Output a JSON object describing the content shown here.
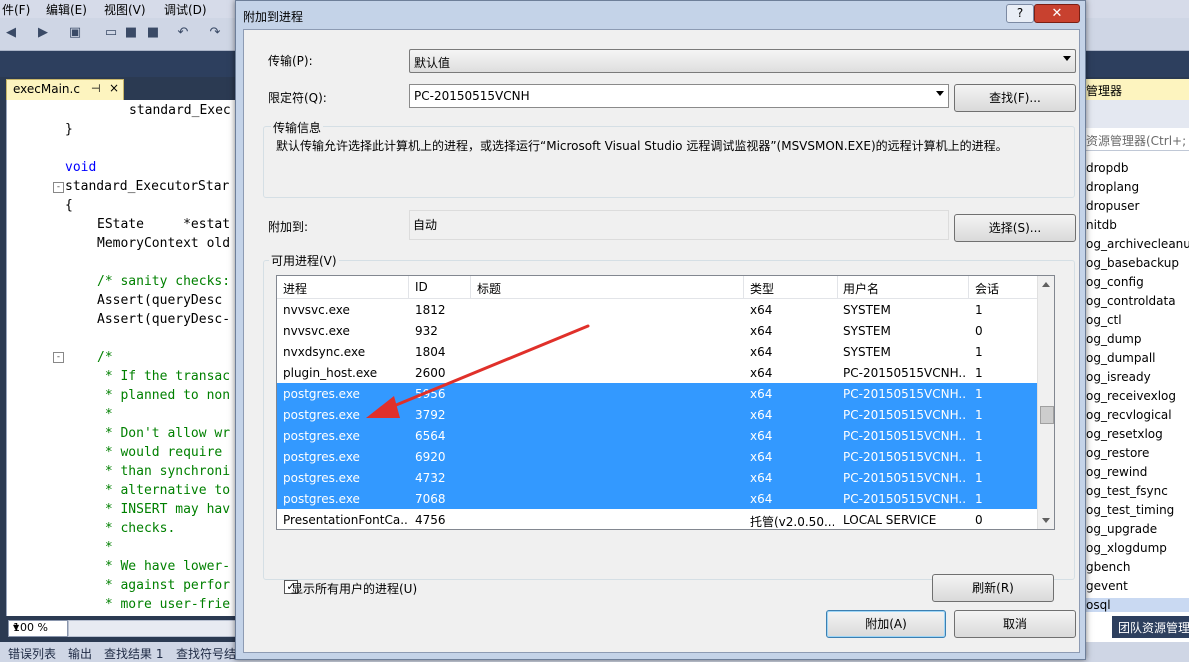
{
  "ide": {
    "menu": [
      "件(F)",
      "编辑(E)",
      "视图(V)",
      "调试(D)"
    ],
    "tab": {
      "file": "execMain.c",
      "pin": "⊣",
      "close": "×"
    },
    "code_lines": [
      {
        "text": "standard_Exec",
        "cls": "tx",
        "indent": 64
      },
      {
        "text": "}",
        "cls": "tx",
        "indent": 0
      },
      {
        "text": "",
        "cls": "tx",
        "indent": 0
      },
      {
        "text": "void",
        "cls": "kw",
        "indent": 0
      },
      {
        "text": "standard_ExecutorStar",
        "cls": "tx",
        "indent": 0
      },
      {
        "text": "{",
        "cls": "tx",
        "indent": 0
      },
      {
        "text": "EState     *estat",
        "cls": "tx",
        "indent": 32
      },
      {
        "text": "MemoryContext old",
        "cls": "tx",
        "indent": 32
      },
      {
        "text": "",
        "cls": "tx",
        "indent": 0
      },
      {
        "text": "/* sanity checks:",
        "cls": "cm",
        "indent": 32
      },
      {
        "text": "Assert(queryDesc ",
        "cls": "tx",
        "indent": 32
      },
      {
        "text": "Assert(queryDesc-",
        "cls": "tx",
        "indent": 32
      },
      {
        "text": "",
        "cls": "tx",
        "indent": 0
      },
      {
        "text": "/*",
        "cls": "cm",
        "indent": 32
      },
      {
        "text": " * If the transac",
        "cls": "cm",
        "indent": 32
      },
      {
        "text": " * planned to non",
        "cls": "cm",
        "indent": 32
      },
      {
        "text": " *",
        "cls": "cm",
        "indent": 32
      },
      {
        "text": " * Don't allow wr",
        "cls": "cm",
        "indent": 32
      },
      {
        "text": " * would require ",
        "cls": "cm",
        "indent": 32
      },
      {
        "text": " * than synchroni",
        "cls": "cm",
        "indent": 32
      },
      {
        "text": " * alternative to",
        "cls": "cm",
        "indent": 32
      },
      {
        "text": " * INSERT may hav",
        "cls": "cm",
        "indent": 32
      },
      {
        "text": " * checks.",
        "cls": "cm",
        "indent": 32
      },
      {
        "text": " *",
        "cls": "cm",
        "indent": 32
      },
      {
        "text": " * We have lower-",
        "cls": "cm",
        "indent": 32
      },
      {
        "text": " * against perfor",
        "cls": "cm",
        "indent": 32
      },
      {
        "text": " * more user-frie",
        "cls": "cm",
        "indent": 32
      }
    ],
    "zoom": "100 %",
    "bottom_tabs": [
      "错误列表",
      "输出",
      "查找结果 1",
      "查找符号结"
    ],
    "solution_explorer": {
      "title": "管理器",
      "search_placeholder": "资源管理器(Ctrl+;",
      "items": [
        "dropdb",
        "droplang",
        "dropuser",
        "nitdb",
        "og_archivecleanup",
        "og_basebackup",
        "og_config",
        "og_controldata",
        "og_ctl",
        "og_dump",
        "og_dumpall",
        "og_isready",
        "og_receivexlog",
        "og_recvlogical",
        "og_resetxlog",
        "og_restore",
        "og_rewind",
        "og_test_fsync",
        "og_test_timing",
        "og_upgrade",
        "og_xlogdump",
        "gbench",
        "gevent",
        "osql"
      ],
      "selected_index": 23,
      "bottom_tab": "团队资源管理"
    }
  },
  "dialog": {
    "title": "附加到进程",
    "help": "?",
    "close": "✕",
    "transport_label": "传输(P):",
    "transport_value": "默认值",
    "qualifier_label": "限定符(Q):",
    "qualifier_value": "PC-20150515VCNH",
    "find_button": "查找(F)...",
    "transport_info_label": "传输信息",
    "transport_info_text": "默认传输允许选择此计算机上的进程，或选择运行“Microsoft Visual Studio 远程调试监视器”(MSVSMON.EXE)的远程计算机上的进程。",
    "attach_to_label": "附加到:",
    "attach_to_value": "自动",
    "select_button": "选择(S)...",
    "available_label": "可用进程(V)",
    "columns": [
      "进程",
      "ID",
      "标题",
      "类型",
      "用户名",
      "会话"
    ],
    "processes": [
      {
        "name": "nvvsvc.exe",
        "id": "1812",
        "title": "",
        "type": "x64",
        "user": "SYSTEM",
        "session": "1",
        "selected": false
      },
      {
        "name": "nvvsvc.exe",
        "id": "932",
        "title": "",
        "type": "x64",
        "user": "SYSTEM",
        "session": "0",
        "selected": false
      },
      {
        "name": "nvxdsync.exe",
        "id": "1804",
        "title": "",
        "type": "x64",
        "user": "SYSTEM",
        "session": "1",
        "selected": false
      },
      {
        "name": "plugin_host.exe",
        "id": "2600",
        "title": "",
        "type": "x64",
        "user": "PC-20150515VCNH...",
        "session": "1",
        "selected": false
      },
      {
        "name": "postgres.exe",
        "id": "5956",
        "title": "",
        "type": "x64",
        "user": "PC-20150515VCNH...",
        "session": "1",
        "selected": true
      },
      {
        "name": "postgres.exe",
        "id": "3792",
        "title": "",
        "type": "x64",
        "user": "PC-20150515VCNH...",
        "session": "1",
        "selected": true
      },
      {
        "name": "postgres.exe",
        "id": "6564",
        "title": "",
        "type": "x64",
        "user": "PC-20150515VCNH...",
        "session": "1",
        "selected": true
      },
      {
        "name": "postgres.exe",
        "id": "6920",
        "title": "",
        "type": "x64",
        "user": "PC-20150515VCNH...",
        "session": "1",
        "selected": true
      },
      {
        "name": "postgres.exe",
        "id": "4732",
        "title": "",
        "type": "x64",
        "user": "PC-20150515VCNH...",
        "session": "1",
        "selected": true
      },
      {
        "name": "postgres.exe",
        "id": "7068",
        "title": "",
        "type": "x64",
        "user": "PC-20150515VCNH...",
        "session": "1",
        "selected": true
      },
      {
        "name": "PresentationFontCa...",
        "id": "4756",
        "title": "",
        "type": "托管(v2.0.50...",
        "user": "LOCAL SERVICE",
        "session": "0",
        "selected": false
      }
    ],
    "show_all_users_label": "显示所有用户的进程(U)",
    "show_all_users_checked": true,
    "refresh_button": "刷新(R)",
    "attach_button": "附加(A)",
    "cancel_button": "取消"
  }
}
